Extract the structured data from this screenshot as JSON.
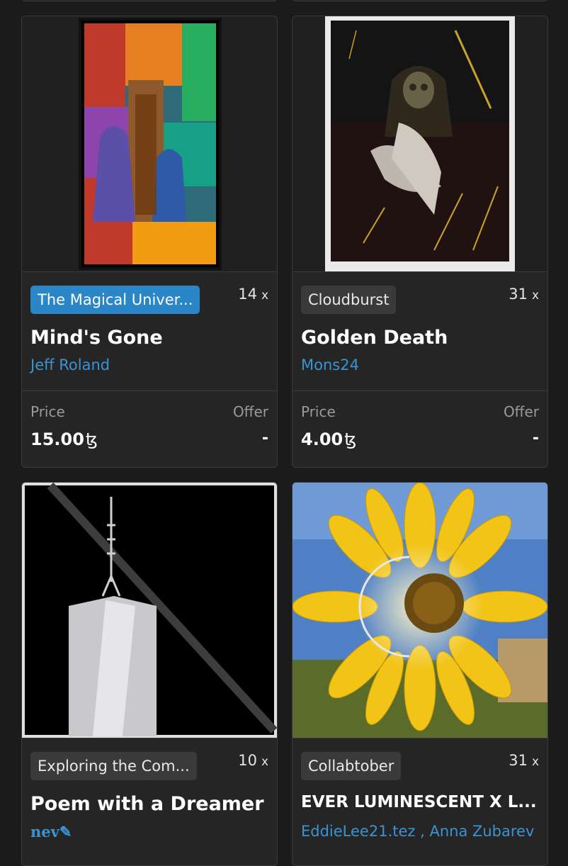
{
  "cards": [
    {
      "collection": "The Magical Univer...",
      "count": "14",
      "count_suffix": "x",
      "title": "Mind's Gone",
      "artist": "Jeff Roland",
      "price_label": "Price",
      "price_value": "15.00",
      "currency": "ꜩ",
      "offer_label": "Offer",
      "offer_value": "-"
    },
    {
      "collection": "Cloudburst",
      "count": "31",
      "count_suffix": "x",
      "title": "Golden Death",
      "artist": "Mons24",
      "price_label": "Price",
      "price_value": "4.00",
      "currency": "ꜩ",
      "offer_label": "Offer",
      "offer_value": "-"
    },
    {
      "collection": "Exploring the Com...",
      "count": "10",
      "count_suffix": "x",
      "title": "Poem with a Dreamer",
      "artist": "nev✎"
    },
    {
      "collection": "Collabtober",
      "count": "31",
      "count_suffix": "x",
      "title": "EVER LUMINESCENT X L...",
      "artist": "EddieLee21.tez , Anna Zubarev"
    }
  ],
  "colors": {
    "background": "#1b1b1b",
    "card": "#252525",
    "accent_blue": "#2a86c6",
    "link": "#3b93d1"
  }
}
